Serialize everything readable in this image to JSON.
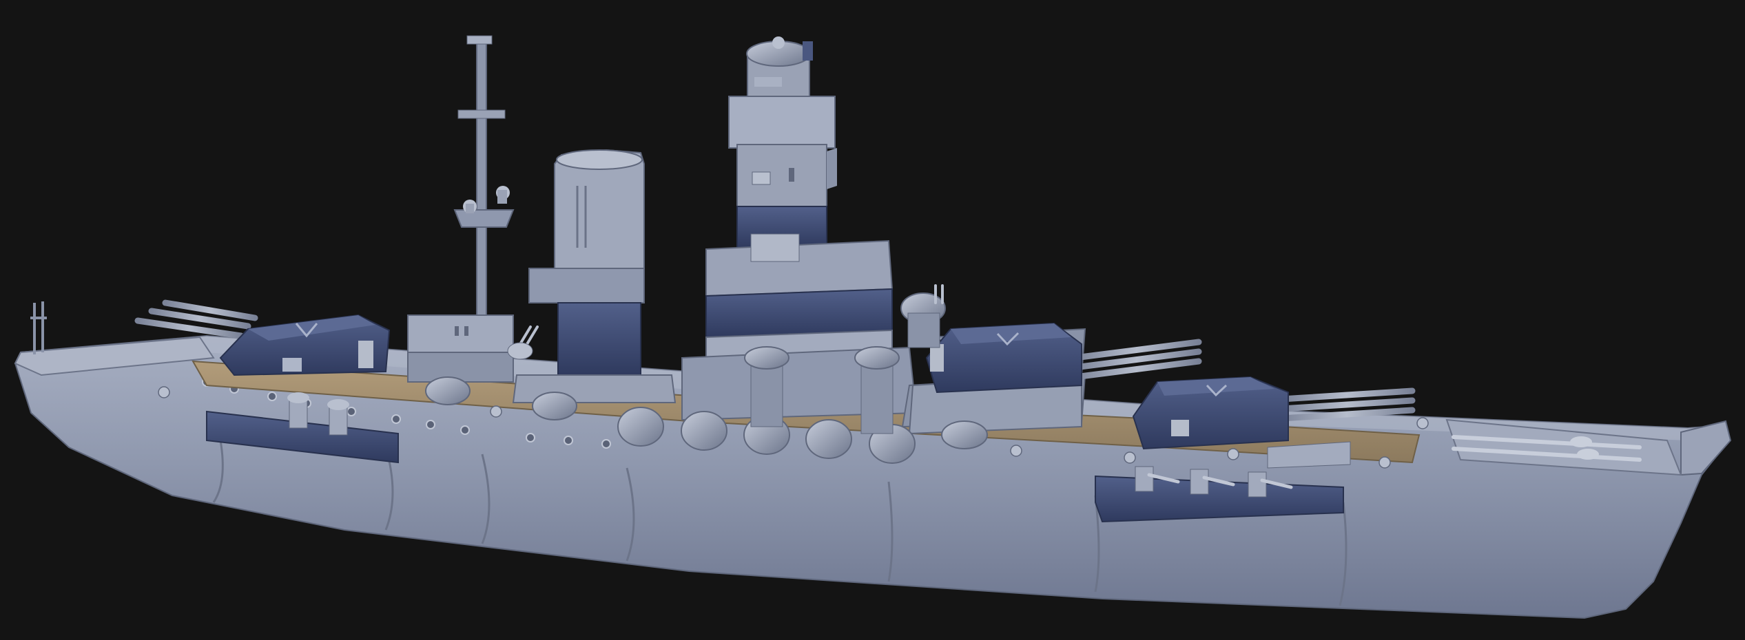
{
  "scene": {
    "subject": "battleship-3d-model-render",
    "background_color": "#141414",
    "colors": {
      "hull": "#8d96ab",
      "hull_light": "#a9b1c3",
      "hull_dark": "#5d6578",
      "navy": "#3f4d75",
      "navy_dark": "#2c3656",
      "deck": "#9d8a6d",
      "steel": "#9aa2b5",
      "steel_light": "#b9c0cf"
    },
    "components": [
      "hull",
      "deck",
      "forward-main-turret",
      "second-main-turret",
      "third-main-turret",
      "mast",
      "funnel",
      "bridge-tower",
      "secondary-gun-mounts",
      "casemate-blisters",
      "bow",
      "stern"
    ]
  }
}
